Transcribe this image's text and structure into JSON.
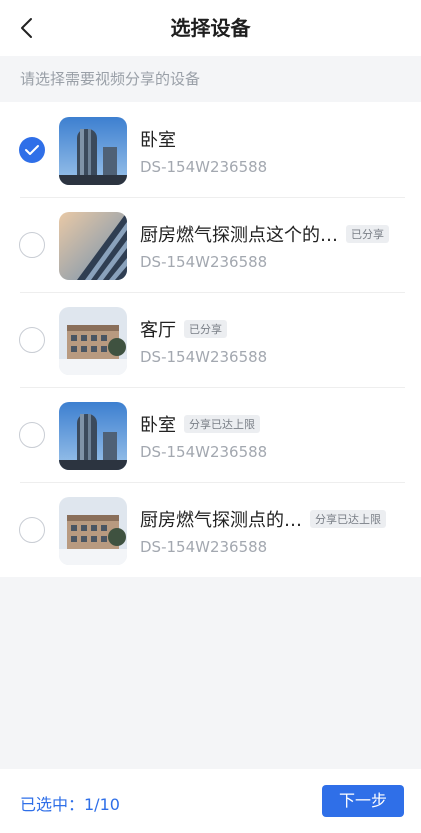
{
  "header": {
    "title": "选择设备",
    "back_icon": "chevron-left-icon"
  },
  "hint": "请选择需要视频分享的设备",
  "devices": [
    {
      "name": "卧室",
      "id": "DS-154W236588",
      "tag": "",
      "checked": true,
      "thumb": "tower"
    },
    {
      "name": "厨房燃气探测点这个的…",
      "id": "DS-154W236588",
      "tag": "已分享",
      "checked": false,
      "thumb": "facade"
    },
    {
      "name": "客厅",
      "id": "DS-154W236588",
      "tag": "已分享",
      "checked": false,
      "thumb": "snow-building"
    },
    {
      "name": "卧室",
      "id": "DS-154W236588",
      "tag": "分享已达上限",
      "checked": false,
      "thumb": "tower"
    },
    {
      "name": "厨房燃气探测点的…",
      "id": "DS-154W236588",
      "tag": "分享已达上限",
      "checked": false,
      "thumb": "snow-building"
    }
  ],
  "footer": {
    "selected_text": "已选中：1/10",
    "next_label": "下一步"
  },
  "colors": {
    "accent": "#2f6fe8",
    "background": "#f4f5f7",
    "tag_bg": "#eceef1"
  }
}
